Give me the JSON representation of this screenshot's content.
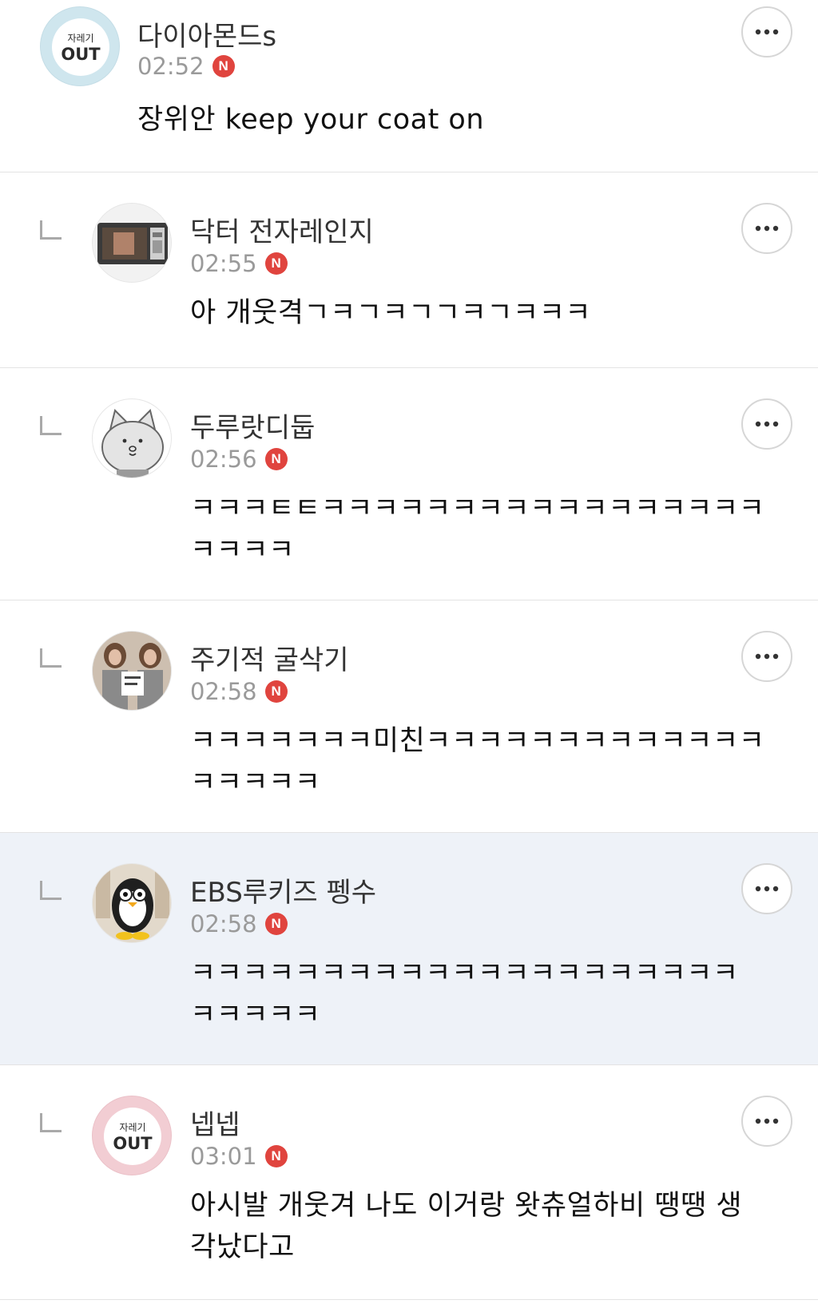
{
  "comments": [
    {
      "author": "다이아몬드s",
      "time": "02:52",
      "badge": "N",
      "text": "장위안 keep your coat on",
      "avatar_text_top": "자레기",
      "avatar_text_bottom": "OUT",
      "avatar_color": "#cfe6ee",
      "is_reply": false
    },
    {
      "author": "닥터 전자레인지",
      "time": "02:55",
      "badge": "N",
      "text": "아 개웃격ㄱㅋㄱㅋㄱㄱㅋㄱㅋㅋㅋ",
      "is_reply": true
    },
    {
      "author": "두루랏디둡",
      "time": "02:56",
      "badge": "N",
      "text": "ㅋㅋㅋㅌㅌㅋㅋㅋㅋㅋㅋㅋㅋㅋㅋㅋㅋㅋㅋㅋㅋㅋ\nㅋㅋㅋㅋ",
      "is_reply": true
    },
    {
      "author": "주기적 굴삭기",
      "time": "02:58",
      "badge": "N",
      "text": "ㅋㅋㅋㅋㅋㅋㅋ미친ㅋㅋㅋㅋㅋㅋㅋㅋㅋㅋㅋㅋㅋ\nㅋㅋㅋㅋㅋ",
      "is_reply": true
    },
    {
      "author": "EBS루키즈 펭수",
      "time": "02:58",
      "badge": "N",
      "text": "ㅋㅋㅋㅋㅋㅋㅋㅋㅋㅋㅋㅋㅋㅋㅋㅋㅋㅋㅋㅋㅋ\nㅋㅋㅋㅋㅋ",
      "is_reply": true
    },
    {
      "author": "넵넵",
      "time": "03:01",
      "badge": "N",
      "text": "아시발 개웃겨 나도 이거랑 왓츄얼하비 땡땡 생\n각났다고",
      "avatar_text_top": "자레기",
      "avatar_text_bottom": "OUT",
      "avatar_color": "#f2cdd3",
      "is_reply": true
    }
  ],
  "icons": {
    "more": "more-horizontal-icon",
    "reply": "reply-arrow-icon",
    "new": "new-badge-icon"
  },
  "colors": {
    "badge": "#e0443e",
    "highlight_row": "#eef2f8",
    "time_text": "#9a9a9a"
  }
}
